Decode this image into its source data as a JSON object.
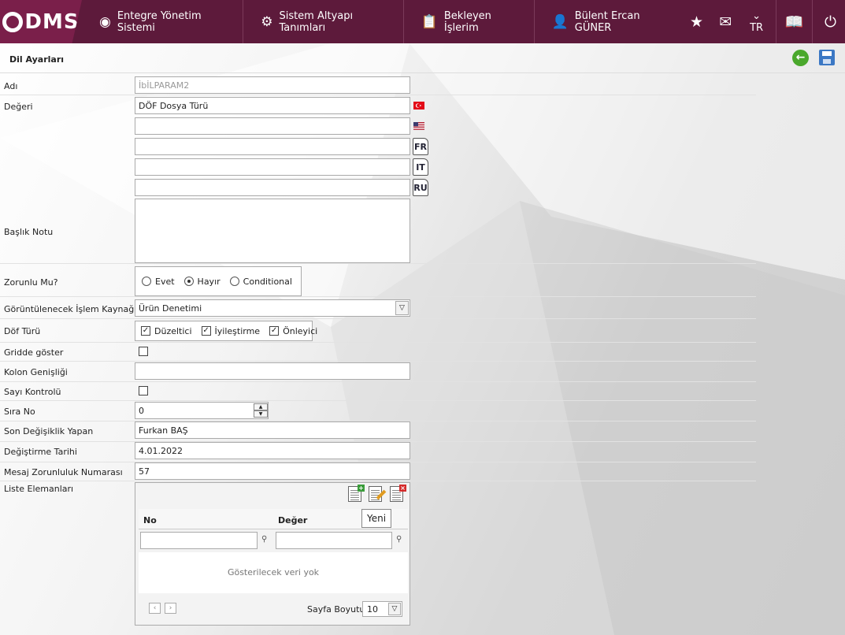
{
  "nav": {
    "logo": "DMS",
    "items": [
      {
        "label": "Entegre Yönetim Sistemi",
        "icon": "qdms-logo-icon"
      },
      {
        "label": "Sistem Altyapı Tanımları",
        "icon": "gear-icon"
      },
      {
        "label": "Bekleyen İşlerim",
        "icon": "clipboard-icon"
      }
    ],
    "user": "Bülent  Ercan GÜNER",
    "lang": "TR"
  },
  "page": {
    "title": "Dil Ayarları"
  },
  "form": {
    "adi_label": "Adı",
    "adi_value": "İbİLPARAM2",
    "degeri_label": "Değeri",
    "degeri_tr": "DÖF Dosya Türü",
    "degeri_en": "",
    "degeri_fr": "",
    "degeri_it": "",
    "degeri_ru": "",
    "lang_fr": "FR",
    "lang_it": "IT",
    "lang_ru": "RU",
    "baslik_label": "Başlık Notu",
    "baslik_value": "",
    "zorunlu_label": "Zorunlu Mu?",
    "zorunlu_options": [
      "Evet",
      "Hayır",
      "Conditional"
    ],
    "zorunlu_selected": "Hayır",
    "kaynak_label": "Görüntülenecek İşlem Kaynağı",
    "kaynak_value": "Ürün Denetimi",
    "dof_label": "Döf Türü",
    "dof_options": [
      "Düzeltici",
      "İyileştirme",
      "Önleyici"
    ],
    "gridde_label": "Gridde göster",
    "kolon_label": "Kolon Genişliği",
    "kolon_value": "",
    "sayi_label": "Sayı Kontrolü",
    "sira_label": "Sıra No",
    "sira_value": "0",
    "son_label": "Son Değişiklik Yapan",
    "son_value": "Furkan BAŞ",
    "tarih_label": "Değiştirme Tarihi",
    "tarih_value": "4.01.2022",
    "mesaj_label": "Mesaj Zorunluluk Numarası",
    "mesaj_value": "57",
    "liste_label": "Liste Elemanları"
  },
  "grid": {
    "columns": [
      "No",
      "Değer"
    ],
    "empty": "Gösterilecek veri yok",
    "page_size_label": "Sayfa Boyutu:",
    "page_size": "10",
    "tooltip": "Yeni"
  },
  "colors": {
    "topbar": "#5d1a3b",
    "logo_bg": "#7a1f4a",
    "back": "#4aa82c",
    "save": "#3b78c4"
  }
}
